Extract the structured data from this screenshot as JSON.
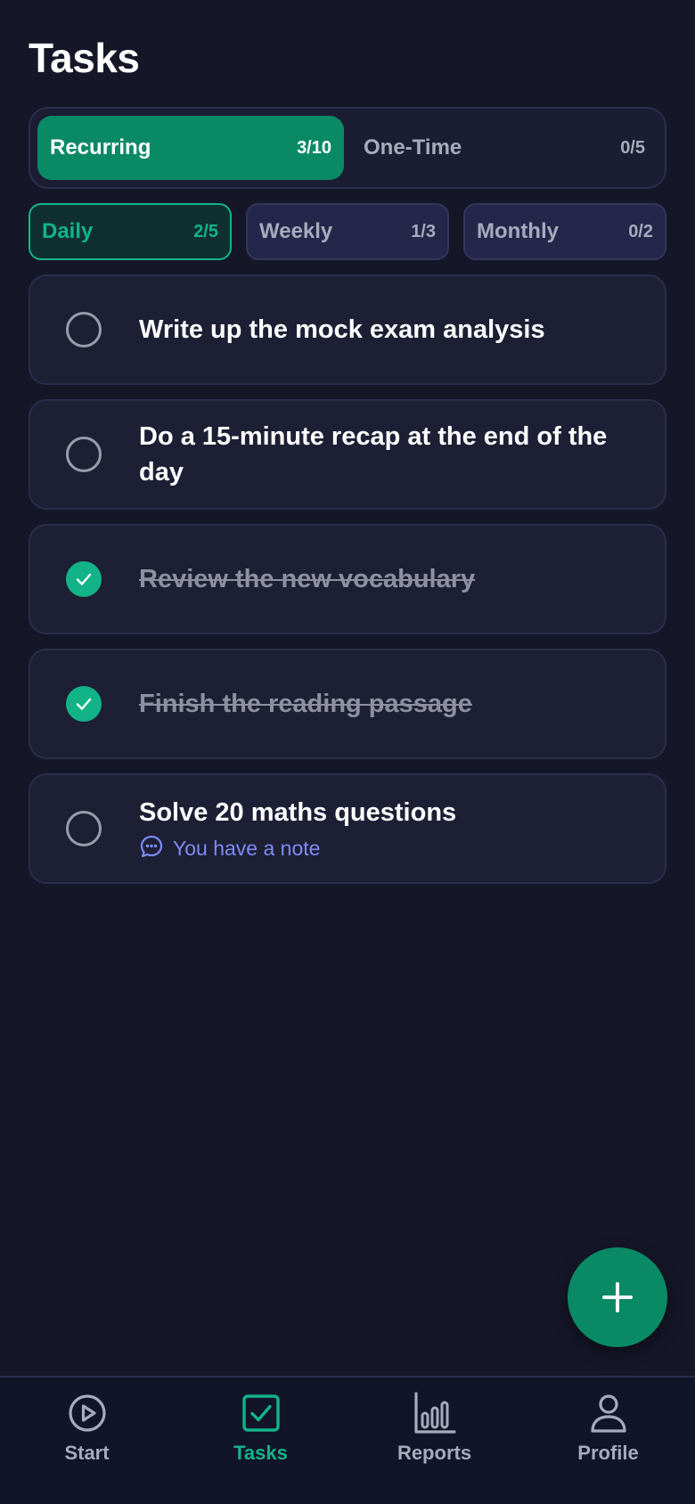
{
  "header": {
    "title": "Tasks"
  },
  "segment": {
    "items": [
      {
        "label": "Recurring",
        "count": "3/10",
        "active": true
      },
      {
        "label": "One-Time",
        "count": "0/5",
        "active": false
      }
    ]
  },
  "filters": {
    "items": [
      {
        "label": "Daily",
        "count": "2/5",
        "active": true
      },
      {
        "label": "Weekly",
        "count": "1/3",
        "active": false
      },
      {
        "label": "Monthly",
        "count": "0/2",
        "active": false
      }
    ]
  },
  "tasks": [
    {
      "text": "Write up the mock exam analysis",
      "done": false
    },
    {
      "text": "Do a 15-minute recap at the end of the day",
      "done": false
    },
    {
      "text": "Review the new vocabulary",
      "done": true
    },
    {
      "text": "Finish the reading passage",
      "done": true
    },
    {
      "text": "Solve 20 maths questions",
      "done": false,
      "note": "You have a note"
    }
  ],
  "nav": {
    "items": [
      {
        "label": "Start",
        "icon": "play-circle-icon",
        "active": false
      },
      {
        "label": "Tasks",
        "icon": "checkbox-icon",
        "active": true
      },
      {
        "label": "Reports",
        "icon": "bar-chart-icon",
        "active": false
      },
      {
        "label": "Profile",
        "icon": "user-icon",
        "active": false
      }
    ]
  },
  "colors": {
    "background": "#151729",
    "accent": "#0a8a64",
    "accent_bright": "#12b487",
    "note": "#7d8cf5"
  }
}
